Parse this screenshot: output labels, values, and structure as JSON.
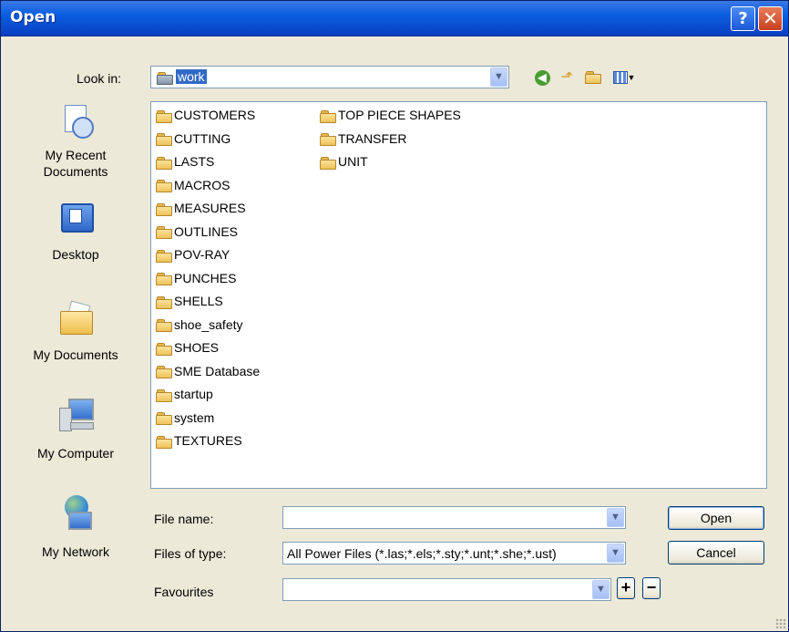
{
  "window": {
    "title": "Open",
    "help_symbol": "?",
    "close_symbol": "✕"
  },
  "look_in": {
    "label": "Look in:",
    "value": "work"
  },
  "places": [
    {
      "label": "My Recent Documents",
      "icon": "recent-documents-icon"
    },
    {
      "label": "Desktop",
      "icon": "desktop-icon"
    },
    {
      "label": "My Documents",
      "icon": "my-documents-icon"
    },
    {
      "label": "My Computer",
      "icon": "my-computer-icon"
    },
    {
      "label": "My Network",
      "icon": "my-network-icon"
    }
  ],
  "files_col1": [
    "CUSTOMERS",
    "CUTTING",
    "LASTS",
    "MACROS",
    "MEASURES",
    "OUTLINES",
    "POV-RAY",
    "PUNCHES",
    "SHELLS",
    "shoe_safety",
    "SHOES",
    "SME Database",
    "startup",
    "system",
    "TEXTURES"
  ],
  "files_col2": [
    "TOP PIECE SHAPES",
    "TRANSFER",
    "UNIT"
  ],
  "file_name": {
    "label": "File name:",
    "value": ""
  },
  "file_type": {
    "label": "Files of type:",
    "value": "All Power Files (*.las;*.els;*.sty;*.unt;*.she;*.ust)"
  },
  "favourites": {
    "label": "Favourites",
    "value": ""
  },
  "buttons": {
    "open": "Open",
    "cancel": "Cancel",
    "plus": "+",
    "minus": "−"
  },
  "colors": {
    "titlebar": "#0a5ee0",
    "selection": "#316ac5",
    "folder": "#eec35a"
  }
}
